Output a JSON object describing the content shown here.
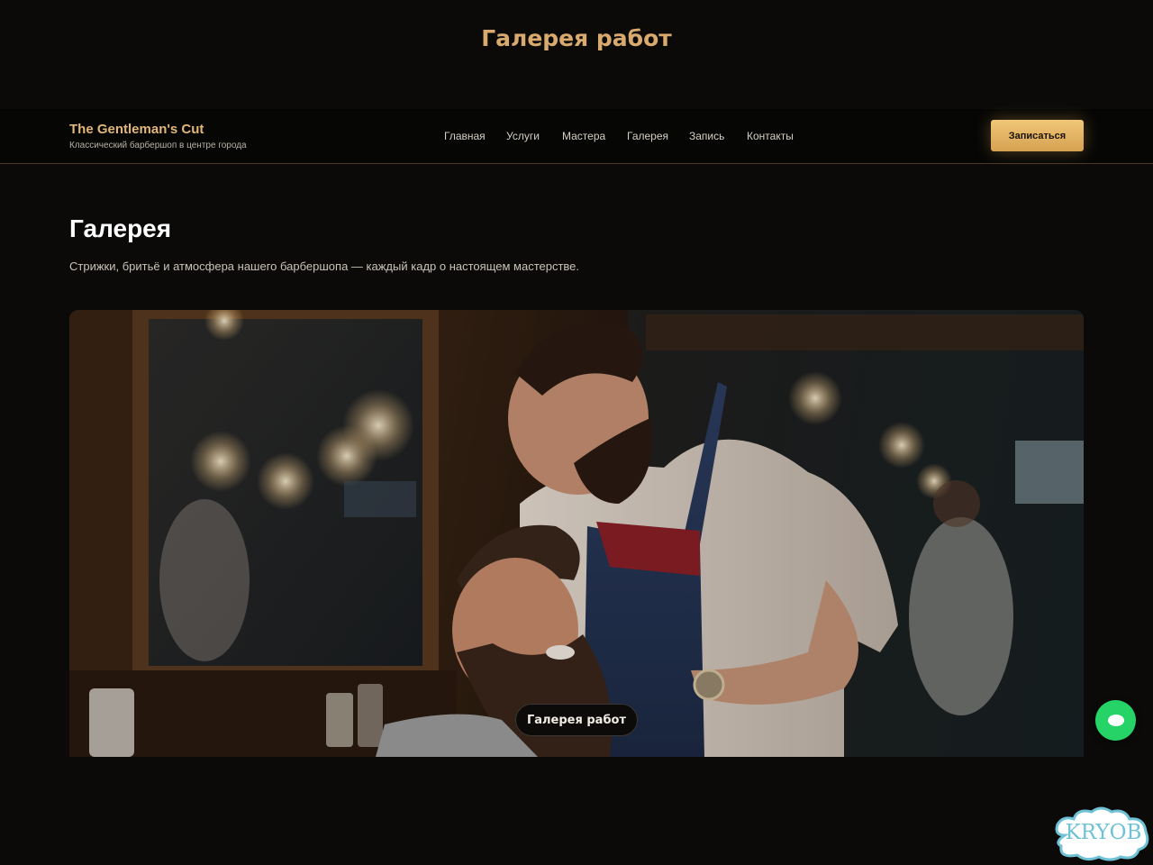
{
  "page": {
    "heading": "Галерея работ"
  },
  "navbar": {
    "brand_name": "The Gentleman's Cut",
    "brand_tagline": "Классический барбершоп в центре города",
    "links": [
      "Главная",
      "Услуги",
      "Мастера",
      "Галерея",
      "Запись",
      "Контакты"
    ],
    "cta_label": "Записаться"
  },
  "gallery": {
    "title": "Галерея",
    "subtitle": "Стрижки, бритьё и атмосфера нашего барбершопа — каждый кадр о настоящем мастерстве.",
    "caption": "Галерея работ"
  },
  "chat_widget": {
    "icon": "chat-icon",
    "color": "#25d366"
  },
  "watermark": {
    "text": "KRYOB"
  },
  "colors": {
    "accent": "#d9aa6d",
    "background": "#0b0a09",
    "button": "#e6b466"
  }
}
